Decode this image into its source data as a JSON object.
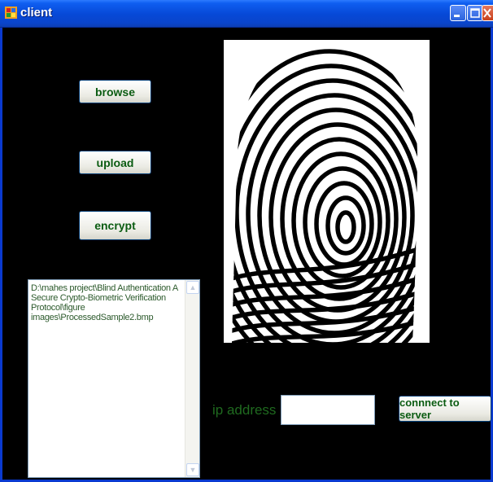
{
  "window": {
    "title": "client"
  },
  "buttons": {
    "browse": "browse",
    "upload": "upload",
    "encrypt": "encrypt",
    "connect": "connnect to server"
  },
  "path_text": "D:\\mahes project\\Blind Authentication A Secure Crypto-Biometric Verification Protocol\\figure images\\ProcessedSample2.bmp",
  "ip": {
    "label": "ip address",
    "value": ""
  },
  "colors": {
    "text_green": "#0b5c12",
    "label_green": "#1f6a1f",
    "client_bg": "#000000"
  }
}
